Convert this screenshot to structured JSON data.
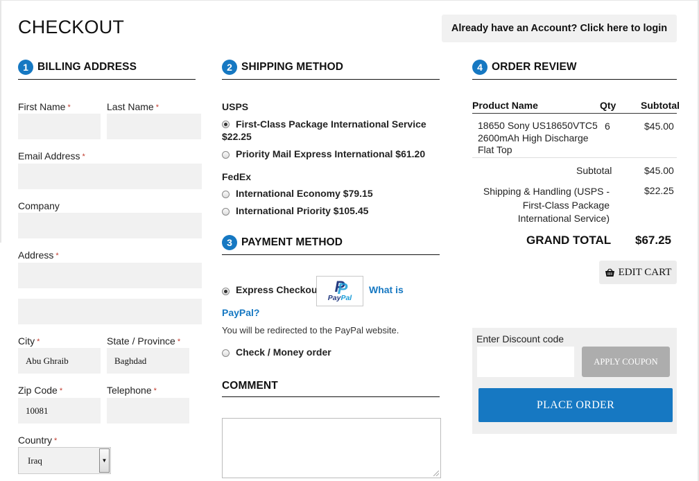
{
  "page": {
    "title": "CHECKOUT",
    "login_prompt": "Already have an Account? Click here to login"
  },
  "billing": {
    "step": "1",
    "heading": "BILLING ADDRESS",
    "labels": {
      "first_name": "First Name",
      "last_name": "Last Name",
      "email": "Email Address",
      "company": "Company",
      "address": "Address",
      "city": "City",
      "state": "State / Province",
      "zip": "Zip Code",
      "telephone": "Telephone",
      "country": "Country"
    },
    "required_mark": "*",
    "values": {
      "first_name": "",
      "last_name": "",
      "email": "",
      "company": "",
      "address_line1": "",
      "address_line2": "",
      "city": "Abu Ghraib",
      "state": "Baghdad",
      "zip": "10081",
      "telephone": "",
      "country": "Iraq"
    }
  },
  "shipping": {
    "step": "2",
    "heading": "SHIPPING METHOD",
    "carriers": [
      {
        "name": "USPS",
        "options": [
          {
            "label": "First-Class Package International Service",
            "price": "$22.25",
            "selected": true
          },
          {
            "label": "Priority Mail Express International $61.20",
            "price": "",
            "selected": false
          }
        ]
      },
      {
        "name": "FedEx",
        "options": [
          {
            "label": "International Economy $79.15",
            "price": "",
            "selected": false
          },
          {
            "label": "International Priority $105.45",
            "price": "",
            "selected": false
          }
        ]
      }
    ]
  },
  "payment": {
    "step": "3",
    "heading": "PAYMENT METHOD",
    "express_label": "Express Checkout",
    "what_is_1": "What is",
    "what_is_2": "PayPal?",
    "redirect_note": "You will be redirected to the PayPal website.",
    "check_label": "Check / Money order",
    "paypal_logo": {
      "text_a": "Pay",
      "text_b": "Pal",
      "glyph": "P"
    }
  },
  "comment": {
    "heading": "COMMENT",
    "value": ""
  },
  "review": {
    "step": "4",
    "heading": "ORDER REVIEW",
    "columns": [
      "Product Name",
      "Qty",
      "Subtotal"
    ],
    "items": [
      {
        "name_lines": [
          "18650 Sony US18650VTC5",
          "2600mAh High Discharge",
          "Flat Top"
        ],
        "qty": "6",
        "subtotal": "$45.00"
      }
    ],
    "subtotal_label": "Subtotal",
    "subtotal_value": "$45.00",
    "shipping_label_lines": [
      "Shipping & Handling (USPS -",
      "First-Class Package",
      "International Service)"
    ],
    "shipping_value": "$22.25",
    "grand_total_label": "GRAND TOTAL",
    "grand_total_value": "$67.25",
    "edit_cart": "EDIT CART"
  },
  "discount": {
    "label": "Enter Discount code",
    "value": "",
    "apply_label": "APPLY COUPON",
    "place_order_label": "PLACE ORDER"
  },
  "colors": {
    "accent": "#1678c2",
    "field_bg": "#f1f1f1",
    "required": "#c0392b",
    "apply_btn": "#adadad"
  }
}
